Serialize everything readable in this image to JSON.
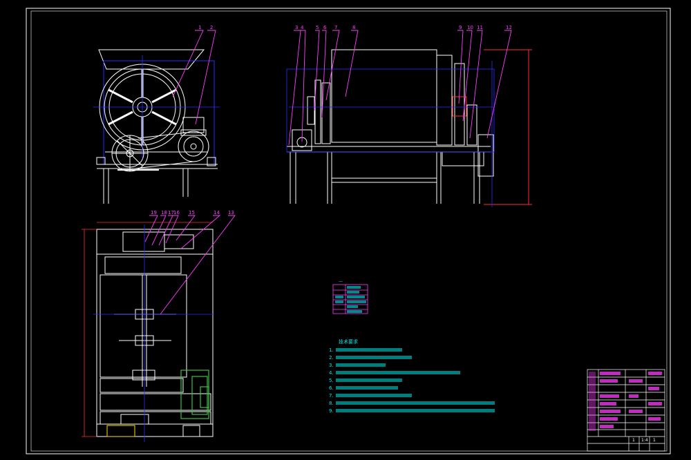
{
  "balloons": {
    "front": [
      "1",
      "2"
    ],
    "side_left": [
      "3",
      "4",
      "5",
      "6",
      "7",
      "8"
    ],
    "side_right": [
      "9",
      "10",
      "11",
      "12"
    ],
    "top": [
      "19",
      "18",
      "17",
      "16",
      "15",
      "14",
      "13"
    ]
  },
  "notes": {
    "title": "技术要求",
    "items": [
      "1.",
      "2.",
      "3.",
      "4.",
      "5.",
      "6.",
      "7.",
      "8.",
      "9."
    ]
  },
  "title_block": {
    "qty": "1",
    "scale": "1:4",
    "sheet": "1"
  },
  "colors": {
    "background": "#000000",
    "frame": "#ffffff",
    "leader": "#ff3cff",
    "centerline": "#2b2bff",
    "note_text": "#00e6e6",
    "dimension": "#ff3030",
    "motor": "#3fbf3f"
  }
}
